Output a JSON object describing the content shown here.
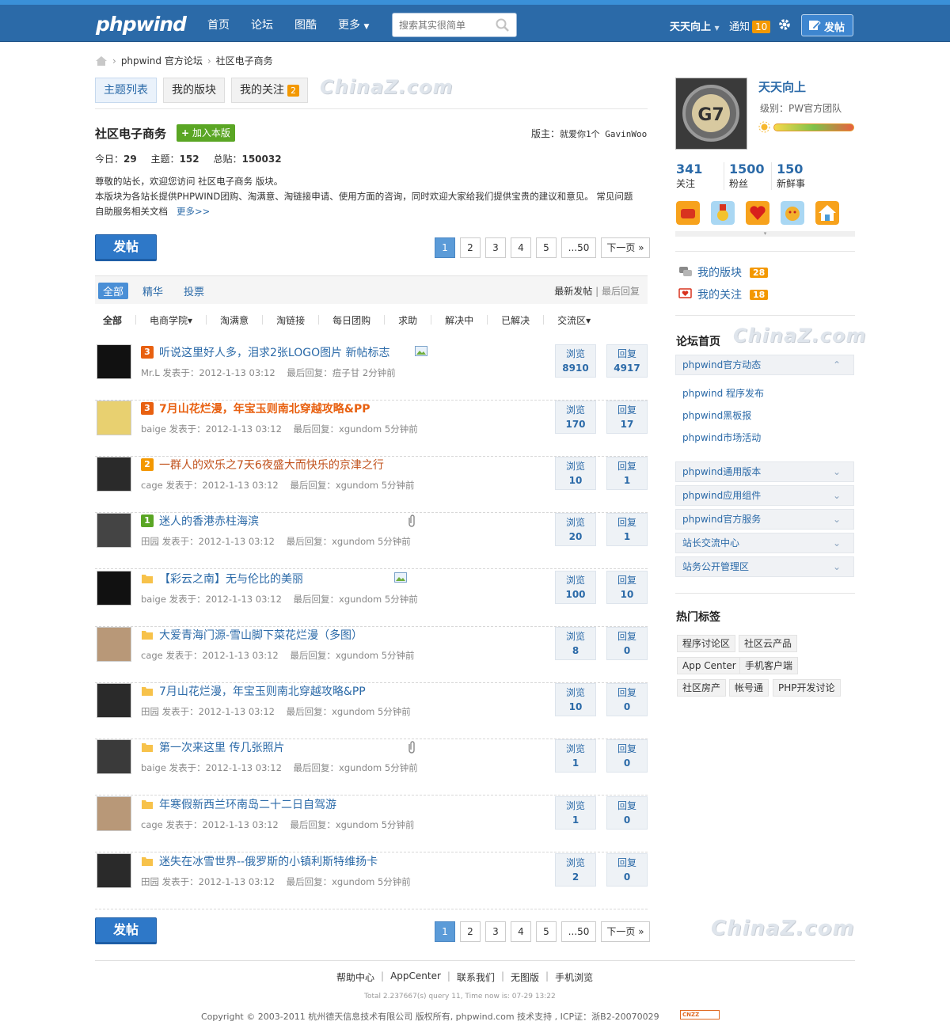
{
  "header": {
    "logo": "phpwind",
    "nav": [
      "首页",
      "论坛",
      "图酷",
      "更多"
    ],
    "search_placeholder": "搜索其实很简单",
    "user": "天天向上",
    "notice_label": "通知",
    "notice_count": "10",
    "post_label": "发帖"
  },
  "breadcrumb": [
    "phpwind 官方论坛",
    "社区电子商务"
  ],
  "tabs": [
    {
      "label": "主题列表"
    },
    {
      "label": "我的版块"
    },
    {
      "label": "我的关注",
      "badge": "2"
    }
  ],
  "watermark": "ChinaZ.com",
  "forum": {
    "name": "社区电子商务",
    "join_label": "加入本版",
    "mods_label": "版主：",
    "mods": "就爱你1个  GavinWoo",
    "today_label": "今日：",
    "today": "29",
    "topics_label": "主题：",
    "topics": "152",
    "posts_label": "总贴：",
    "posts": "150032",
    "desc1": "尊敬的站长，欢迎您访问 社区电子商务 版块。",
    "desc2": "本版块为各站长提供PHPWIND团购、淘满意、淘链接申请、使用方面的咨询，同时欢迎大家给我们提供宝贵的建议和意见。 常见问题",
    "desc3": "自助服务相关文档",
    "more": "更多>>"
  },
  "post_button": "发帖",
  "pager": {
    "pages": [
      "1",
      "2",
      "3",
      "4",
      "5"
    ],
    "last": "...50",
    "next": "下一页 »"
  },
  "filter": {
    "types": [
      "全部",
      "精华",
      "投票"
    ],
    "sort_new": "最新发帖",
    "sort_reply": "最后回复"
  },
  "categories": [
    "全部",
    "电商学院▾",
    "淘满意",
    "淘链接",
    "每日团购",
    "求助",
    "解决中",
    "已解决",
    "交流区▾"
  ],
  "labels": {
    "posted_at": "发表于：",
    "last_reply": "最后回复：",
    "views": "浏览",
    "replies": "回复"
  },
  "threads": [
    {
      "badge": "3",
      "title": "听说这里好人多，泪求2张LOGO图片   新帖标志",
      "author": "Mr.L",
      "time": "2012-1-13 03:12",
      "last": "痘子甘 2分钟前",
      "views": "8910",
      "replies": "4917"
    },
    {
      "badge": "3",
      "title": "7月山花烂漫，年宝玉则南北穿越攻略&PP",
      "author": "baige",
      "time": "2012-1-13 03:12",
      "last": "xgundom 5分钟前",
      "views": "170",
      "replies": "17"
    },
    {
      "badge": "2",
      "title": "一群人的欢乐之7天6夜盛大而快乐的京津之行",
      "author": "cage",
      "time": "2012-1-13 03:12",
      "last": "xgundom 5分钟前",
      "views": "10",
      "replies": "1"
    },
    {
      "badge": "1",
      "title": "迷人的香港赤柱海滨",
      "author": "田园",
      "time": "2012-1-13 03:12",
      "last": "xgundom 5分钟前",
      "views": "20",
      "replies": "1"
    },
    {
      "badge": "",
      "title": "【彩云之南】无与伦比的美丽",
      "author": "baige",
      "time": "2012-1-13 03:12",
      "last": "xgundom 5分钟前",
      "views": "100",
      "replies": "10"
    },
    {
      "badge": "",
      "title": "大爱青海门源-雪山脚下菜花烂漫（多图）",
      "author": "cage",
      "time": "2012-1-13 03:12",
      "last": "xgundom 5分钟前",
      "views": "8",
      "replies": "0"
    },
    {
      "badge": "",
      "title": "7月山花烂漫，年宝玉则南北穿越攻略&PP",
      "author": "田园",
      "time": "2012-1-13 03:12",
      "last": "xgundom 5分钟前",
      "views": "10",
      "replies": "0"
    },
    {
      "badge": "",
      "title": "第一次来这里 传几张照片",
      "author": "baige",
      "time": "2012-1-13 03:12",
      "last": "xgundom 5分钟前",
      "views": "1",
      "replies": "0"
    },
    {
      "badge": "",
      "title": "年寒假新西兰环南岛二十二日自驾游",
      "author": "cage",
      "time": "2012-1-13 03:12",
      "last": "xgundom 5分钟前",
      "views": "1",
      "replies": "0"
    },
    {
      "badge": "",
      "title": "迷失在冰雪世界--俄罗斯的小镇利斯特维扬卡",
      "author": "田园",
      "time": "2012-1-13 03:12",
      "last": "xgundom 5分钟前",
      "views": "2",
      "replies": "0"
    }
  ],
  "profile": {
    "name": "天天向上",
    "level": "级别：PW官方团队",
    "stats": [
      {
        "value": "341",
        "label": "关注"
      },
      {
        "value": "1500",
        "label": "粉丝"
      },
      {
        "value": "150",
        "label": "新鲜事"
      }
    ],
    "my_forums": "我的版块",
    "my_forums_count": "28",
    "my_follows": "我的关注",
    "my_follows_count": "18"
  },
  "forum_home": {
    "title": "论坛首页",
    "groups": [
      "phpwind官方动态",
      "phpwind通用版本",
      "phpwind应用组件",
      "phpwind官方服务",
      "站长交流中心",
      "站务公开管理区"
    ],
    "subs": [
      "phpwind 程序发布",
      "phpwind黑板报",
      "phpwind市场活动"
    ]
  },
  "hot_tags": {
    "title": "热门标签",
    "tags": [
      "程序讨论区",
      "社区云产品",
      "App Center",
      "手机客户端",
      "社区房产",
      "帐号通",
      "PHP开发讨论"
    ]
  },
  "footer": {
    "links": [
      "帮助中心",
      "AppCenter",
      "联系我们",
      "无图版",
      "手机浏览"
    ],
    "total": "Total 2.237667(s) query 11, Time now is: 07-29 13:22",
    "copyright": "Copyright © 2003-2011 杭州德天信息技术有限公司 版权所有, phpwind.com 技术支持 , ICP证：浙B2-20070029",
    "cnzz": "CNZZ"
  },
  "colors": {
    "header": "#2b6aa8",
    "link": "#2b6aa8",
    "badge": "#f39800",
    "hot": "#e86010"
  }
}
